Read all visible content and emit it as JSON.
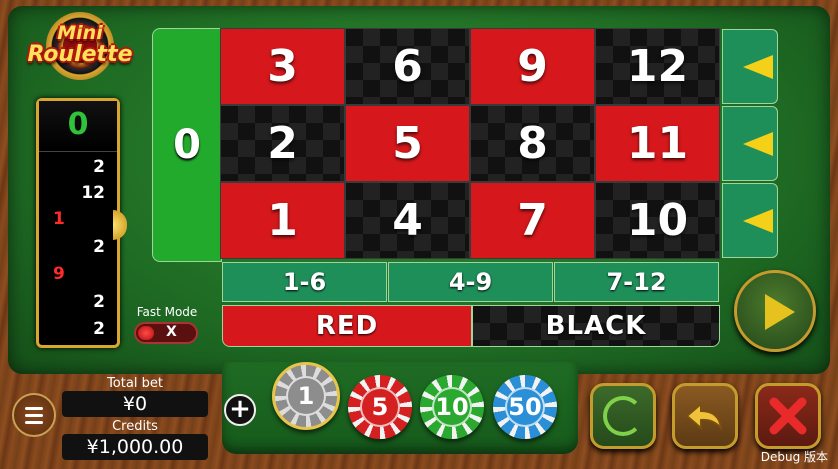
{
  "logo": {
    "line1": "Mini",
    "line2": "Roulette"
  },
  "history": {
    "latest": "0",
    "items": [
      {
        "value": "2",
        "color": "black"
      },
      {
        "value": "12",
        "color": "black"
      },
      {
        "value": "1",
        "color": "red"
      },
      {
        "value": "2",
        "color": "black"
      },
      {
        "value": "9",
        "color": "red"
      },
      {
        "value": "2",
        "color": "black"
      },
      {
        "value": "2",
        "color": "black"
      }
    ]
  },
  "board": {
    "zero": "0",
    "rows": [
      [
        {
          "n": "3",
          "c": "red"
        },
        {
          "n": "6",
          "c": "black"
        },
        {
          "n": "9",
          "c": "red"
        },
        {
          "n": "12",
          "c": "black"
        }
      ],
      [
        {
          "n": "2",
          "c": "black"
        },
        {
          "n": "5",
          "c": "red"
        },
        {
          "n": "8",
          "c": "black"
        },
        {
          "n": "11",
          "c": "red"
        }
      ],
      [
        {
          "n": "1",
          "c": "red"
        },
        {
          "n": "4",
          "c": "black"
        },
        {
          "n": "7",
          "c": "red"
        },
        {
          "n": "10",
          "c": "black"
        }
      ]
    ],
    "ranges": [
      "1-6",
      "4-9",
      "7-12"
    ],
    "red_label": "RED",
    "black_label": "BLACK"
  },
  "fast_mode": {
    "label": "Fast Mode",
    "state": "X"
  },
  "bets": {
    "total_bet_label": "Total bet",
    "total_bet_value": "¥0",
    "credits_label": "Credits",
    "credits_value": "¥1,000.00"
  },
  "chips": [
    {
      "value": "1",
      "color": "#8d8d8d",
      "selected": true
    },
    {
      "value": "5",
      "color": "#d42020"
    },
    {
      "value": "10",
      "color": "#2aa82f"
    },
    {
      "value": "50",
      "color": "#2a8fd6"
    }
  ],
  "debug_label": "Debug 版本",
  "colors": {
    "felt": "#1f6c24",
    "red": "#d6181c",
    "black": "#111111",
    "gold": "#c59b2d"
  }
}
